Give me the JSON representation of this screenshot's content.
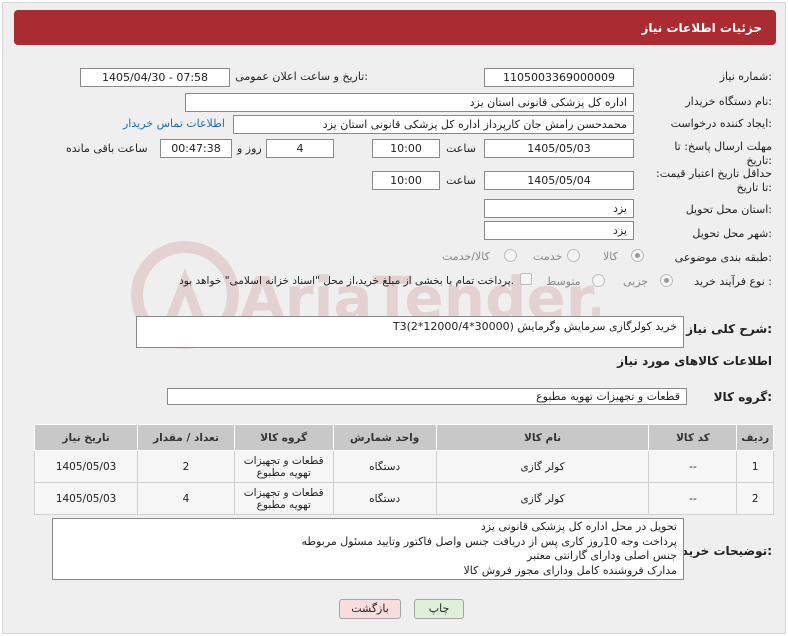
{
  "header": {
    "title": "جزئیات اطلاعات نیاز"
  },
  "fields": {
    "need_number_label": "شماره نیاز:",
    "need_number": "1105003369000009",
    "announce_label": "تاریخ و ساعت اعلان عمومی:",
    "announce_value": "1405/04/30 - 07:58",
    "buyer_org_label": "نام دستگاه خریدار:",
    "buyer_org": "اداره کل پزشکی قانونی استان یزد",
    "requester_label": "ایجاد کننده درخواست:",
    "requester": "محمدحسن رامش جان کارپرداز اداره کل پزشکی قانونی استان یزد",
    "contact_link": "اطلاعات تماس خریدار",
    "deadline_label": "مهلت ارسال پاسخ: تا تاریخ:",
    "deadline_date": "1405/05/03",
    "time_label": "ساعت",
    "deadline_time": "10:00",
    "days_value": "4",
    "days_label": "روز و",
    "remaining_time": "00:47:38",
    "remaining_label": "ساعت باقی مانده",
    "price_validity_label": "حداقل تاریخ اعتبار قیمت: تا تاریخ:",
    "price_date": "1405/05/04",
    "price_time": "10:00",
    "province_label": "استان محل تحویل:",
    "province": "یزد",
    "city_label": "شهر محل تحویل:",
    "city": "یزد",
    "category_label": "طبقه بندی موضوعی:",
    "category_options": [
      "کالا",
      "خدمت",
      "کالا/خدمت"
    ],
    "process_label": "نوع فرآیند خرید :",
    "process_options": [
      "جزیی",
      "متوسط"
    ],
    "payment_note": "پرداخت تمام یا بخشی از مبلغ خرید،از محل \"اسناد خزانه اسلامی\" خواهد بود."
  },
  "description": {
    "label": "شرح کلی نیاز:",
    "value": "خرید کولرگازی سرمایش وگرمایش (30000*12000/4*2)T3"
  },
  "goods_section_title": "اطلاعات کالاهای مورد نیاز",
  "goods_group": {
    "label": "گروه کالا:",
    "value": "قطعات و تجهیزات تهویه مطبوع"
  },
  "table": {
    "headers": [
      "ردیف",
      "کد کالا",
      "نام کالا",
      "واحد شمارش",
      "گروه کالا",
      "تعداد / مقدار",
      "تاریخ نیاز"
    ],
    "rows": [
      [
        "1",
        "--",
        "کولر گازی",
        "دستگاه",
        "قطعات و تجهیزات تهویه مطبوع",
        "2",
        "1405/05/03"
      ],
      [
        "2",
        "--",
        "کولر گازی",
        "دستگاه",
        "قطعات و تجهیزات تهویه مطبوع",
        "4",
        "1405/05/03"
      ]
    ]
  },
  "buyer_notes": {
    "label": "توضیحات خریدار:",
    "lines": [
      "تحویل در محل اداره کل پزشکی قانونی یزد",
      "پرداخت وجه 10روز کاری پس از دریافت جنس واصل فاکتور وتایید مسئول مربوطه",
      "جنس اصلی ودارای گارانتی معتبر",
      "مدارک فروشنده کامل ودارای مجوز فروش کالا"
    ]
  },
  "buttons": {
    "print": "چاپ",
    "back": "بازگشت"
  },
  "watermark": {
    "text": "AriaTender.net"
  },
  "colors": {
    "header": "#ab2b32",
    "link": "#1f6fb4",
    "print_btn": "#dff0d8",
    "back_btn": "#f9dcdc"
  }
}
